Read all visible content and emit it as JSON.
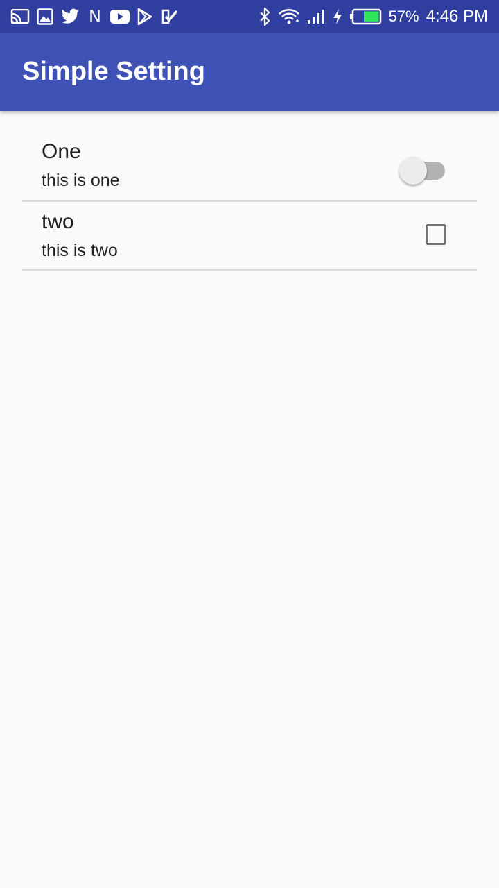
{
  "status_bar": {
    "left_icons": [
      "cast-icon",
      "image-icon",
      "twitter-icon",
      "netflix-icon",
      "youtube-icon",
      "play-store-icon",
      "tasks-icon"
    ],
    "netflix_letter": "N",
    "right_icons": [
      "bluetooth-icon",
      "wifi-icon",
      "signal-icon",
      "charging-icon",
      "battery-icon"
    ],
    "battery_percent": "57%",
    "time": "4:46 PM",
    "battery_color": "#2ee65a"
  },
  "app_bar": {
    "title": "Simple Setting",
    "color": "#3f51b5"
  },
  "preferences": [
    {
      "title": "One",
      "summary": "this is one",
      "widget": "switch",
      "checked": false
    },
    {
      "title": "two",
      "summary": "this is two",
      "widget": "checkbox",
      "checked": false
    }
  ]
}
